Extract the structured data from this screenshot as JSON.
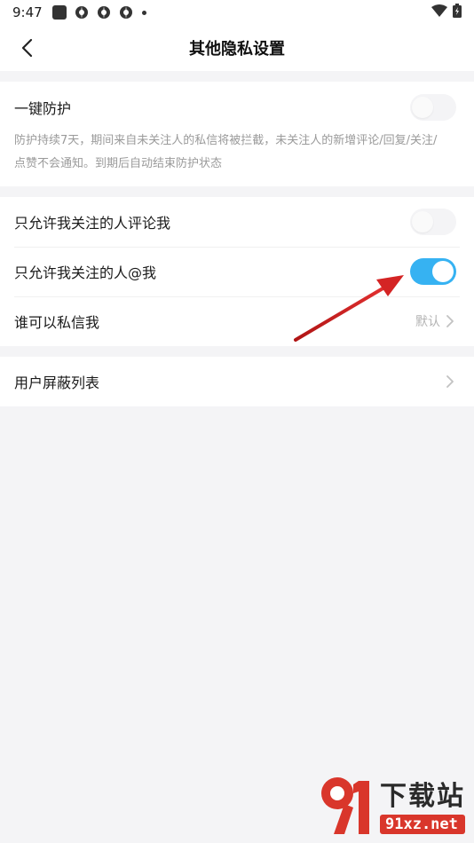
{
  "status_bar": {
    "time": "9:47",
    "icons": [
      "app-square-icon",
      "sync-icon",
      "sync-icon",
      "sync-icon",
      "dot-icon",
      "wifi-icon",
      "battery-icon"
    ]
  },
  "header": {
    "title": "其他隐私设置",
    "back_icon": "back-arrow-icon"
  },
  "protect": {
    "label": "一键防护",
    "desc_line1": "防护持续7天，期间来自未关注人的私信将被拦截，未关注人的新增评论/回复/关注/",
    "desc_line2": "点赞不会通知。到期后自动结束防护状态",
    "enabled": false
  },
  "settings": [
    {
      "label": "只允许我关注的人评论我",
      "type": "toggle",
      "enabled": false
    },
    {
      "label": "只允许我关注的人@我",
      "type": "toggle",
      "enabled": true
    },
    {
      "label": "谁可以私信我",
      "type": "link",
      "value": "默认"
    }
  ],
  "block_list": {
    "label": "用户屏蔽列表"
  },
  "colors": {
    "accent": "#36b2f2",
    "background": "#f4f4f6",
    "annotation_arrow": "#d32222",
    "watermark_red": "#d9362b"
  },
  "watermark": {
    "title": "下载站",
    "domain": "91xz.net"
  }
}
